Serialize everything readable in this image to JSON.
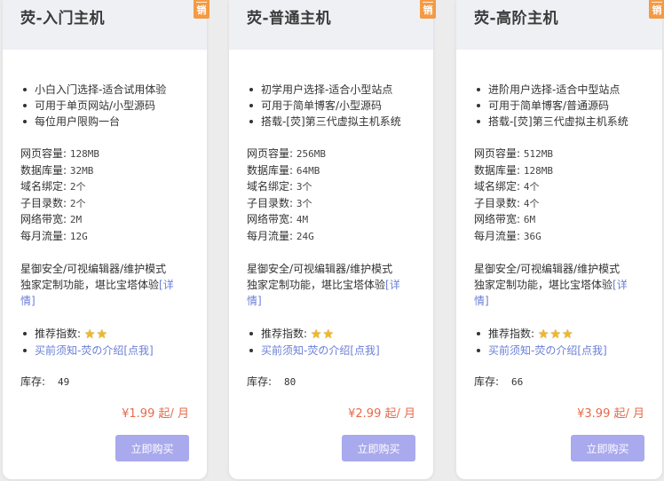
{
  "cards": [
    {
      "title": "荧-入门主机",
      "badge": "销",
      "features": [
        "小白入门选择-适合试用体验",
        "可用于单页网站/小型源码",
        "每位用户限购一台"
      ],
      "specs": [
        {
          "label": "网页容量:",
          "value": "128MB"
        },
        {
          "label": "数据库量:",
          "value": "32MB"
        },
        {
          "label": "域名绑定:",
          "value": "2个"
        },
        {
          "label": "子目录数:",
          "value": "2个"
        },
        {
          "label": "网络带宽:",
          "value": "2M"
        },
        {
          "label": "每月流量:",
          "value": "12G"
        }
      ],
      "desc_line1": "星御安全/可视编辑器/维护模式",
      "desc_line2": "独家定制功能，堪比宝塔体验",
      "desc_link1": "[详",
      "desc_link2": "情]",
      "rating_label": "推荐指数:",
      "rating": 2,
      "notice_link": "买前须知-荧の介绍[点我]",
      "stock_label": "库存:",
      "stock": "49",
      "price": "¥1.99 起/ 月",
      "buy_label": "立即购买"
    },
    {
      "title": "荧-普通主机",
      "badge": "销",
      "features": [
        "初学用户选择-适合小型站点",
        "可用于简单博客/小型源码",
        "搭载-[荧]第三代虚拟主机系统"
      ],
      "specs": [
        {
          "label": "网页容量:",
          "value": "256MB"
        },
        {
          "label": "数据库量:",
          "value": "64MB"
        },
        {
          "label": "域名绑定:",
          "value": "3个"
        },
        {
          "label": "子目录数:",
          "value": "3个"
        },
        {
          "label": "网络带宽:",
          "value": "4M"
        },
        {
          "label": "每月流量:",
          "value": "24G"
        }
      ],
      "desc_line1": "星御安全/可视编辑器/维护模式",
      "desc_line2": "独家定制功能，堪比宝塔体验",
      "desc_link1": "[详",
      "desc_link2": "情]",
      "rating_label": "推荐指数:",
      "rating": 2,
      "notice_link": "买前须知-荧の介绍[点我]",
      "stock_label": "库存:",
      "stock": "80",
      "price": "¥2.99 起/ 月",
      "buy_label": "立即购买"
    },
    {
      "title": "荧-高阶主机",
      "badge": "销",
      "features": [
        "进阶用户选择-适合中型站点",
        "可用于简单博客/普通源码",
        "搭载-[荧]第三代虚拟主机系统"
      ],
      "specs": [
        {
          "label": "网页容量:",
          "value": "512MB"
        },
        {
          "label": "数据库量:",
          "value": "128MB"
        },
        {
          "label": "域名绑定:",
          "value": "4个"
        },
        {
          "label": "子目录数:",
          "value": "4个"
        },
        {
          "label": "网络带宽:",
          "value": "6M"
        },
        {
          "label": "每月流量:",
          "value": "36G"
        }
      ],
      "desc_line1": "星御安全/可视编辑器/维护模式",
      "desc_line2": "独家定制功能，堪比宝塔体验",
      "desc_link1": "[详",
      "desc_link2": "情]",
      "rating_label": "推荐指数:",
      "rating": 3,
      "notice_link": "买前须知-荧の介绍[点我]",
      "stock_label": "库存:",
      "stock": "66",
      "price": "¥3.99 起/ 月",
      "buy_label": "立即购买"
    }
  ],
  "colors": {
    "badge": "#f49a45",
    "price": "#e56a4a",
    "link": "#6a7fd6",
    "button": "#a9a9ee",
    "star": "#f6b81d"
  },
  "icons": {
    "rating_star": "star-icon"
  }
}
